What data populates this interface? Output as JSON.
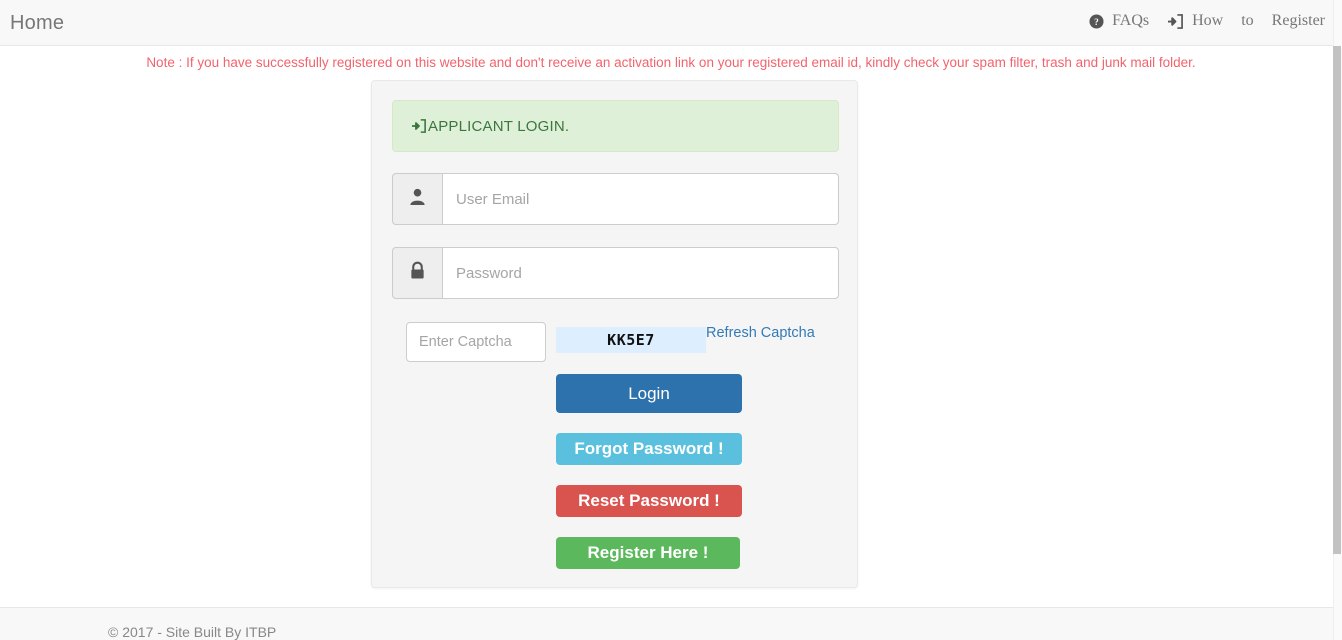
{
  "navbar": {
    "brand": "Home",
    "items": [
      {
        "label": "FAQs",
        "icon": "question-circle-icon"
      },
      {
        "label": "How",
        "icon": "sign-in-icon"
      },
      {
        "label": "to",
        "icon": ""
      },
      {
        "label": "Register",
        "icon": ""
      }
    ]
  },
  "note": {
    "text": "Note : If you have successfully registered on this website and don't receive an activation link on your registered email id, kindly check your spam filter, trash and junk mail folder.",
    "color": "#f2636c"
  },
  "login": {
    "panel_title": "APPLICANT LOGIN.",
    "panel_icon": "sign-in-icon",
    "panel_bg": "#dff0d8",
    "panel_text_color": "#3c763d",
    "email": {
      "placeholder": "User Email",
      "value": "",
      "icon": "user-icon"
    },
    "password": {
      "placeholder": "Password",
      "value": "",
      "icon": "lock-icon"
    },
    "captcha": {
      "placeholder": "Enter Captcha",
      "value": "",
      "code": "KK5E7",
      "code_bg": "#ddeeff",
      "refresh_label": "Refresh Captcha",
      "refresh_color": "#337ab7"
    },
    "buttons": {
      "login": {
        "label": "Login",
        "color": "#2e72ad"
      },
      "forgot": {
        "label": "Forgot Password !",
        "color": "#5bc0de"
      },
      "reset": {
        "label": "Reset Password !",
        "color": "#d9534f"
      },
      "register": {
        "label": "Register Here !",
        "color": "#5cb85c"
      }
    }
  },
  "footer": {
    "text": "© 2017 - Site Built By ITBP"
  }
}
